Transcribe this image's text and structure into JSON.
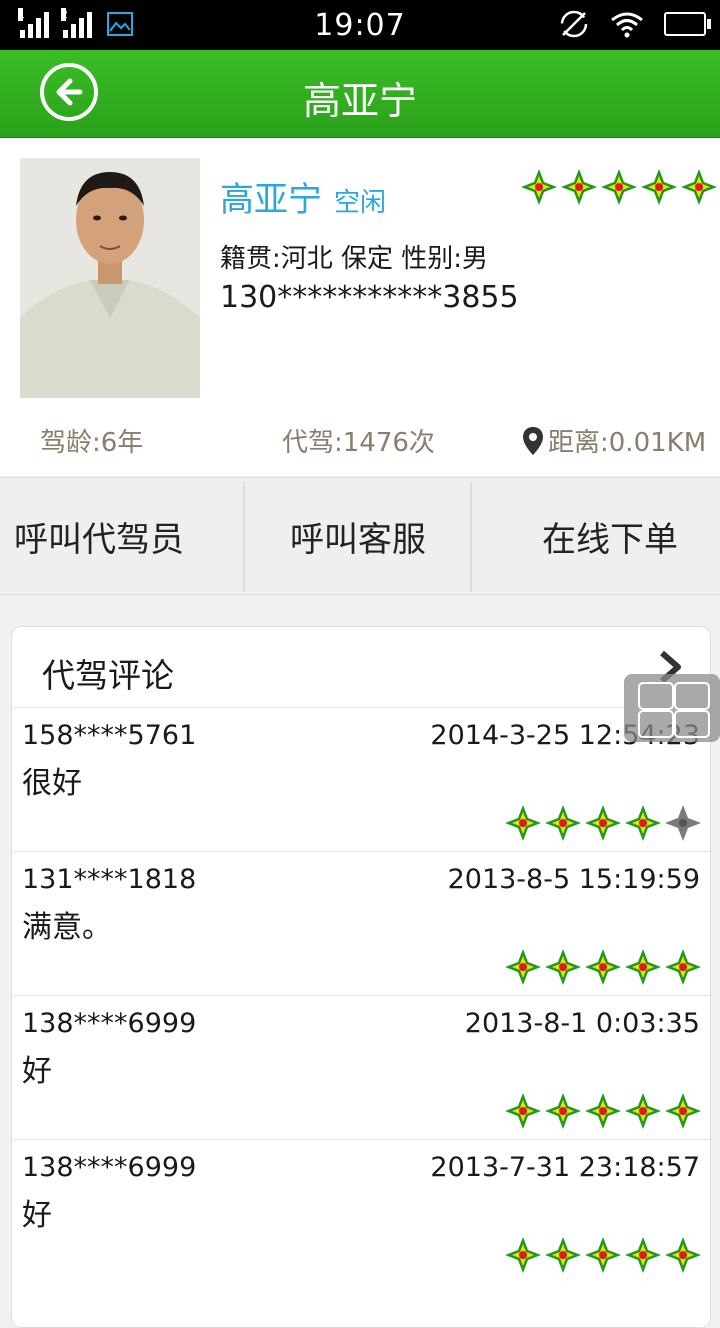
{
  "status_bar": {
    "time": "19:07",
    "sim1": "1",
    "sim2": "2",
    "icons": [
      "signal-icon",
      "image-icon",
      "rotation-icon",
      "wifi-icon",
      "battery-icon"
    ]
  },
  "header": {
    "title": "高亚宁",
    "back_icon": "back-arrow-icon"
  },
  "driver": {
    "name": "高亚宁",
    "status": "空闲",
    "rating": 5,
    "origin_gender": "籍贯:河北 保定   性别:男",
    "phone": "130***********3855",
    "driving_age": "驾龄:6年",
    "drive_count": "代驾:1476次",
    "distance": "距离:0.01KM"
  },
  "actions": {
    "call_driver": "呼叫代驾员",
    "call_service": "呼叫客服",
    "order_online": "在线下单"
  },
  "reviews": {
    "title": "代驾评论",
    "items": [
      {
        "user": "158****5761",
        "date": "2014-3-25 12:54:23",
        "text": "很好",
        "rating": 4
      },
      {
        "user": "131****1818",
        "date": "2013-8-5 15:19:59",
        "text": "满意。",
        "rating": 5
      },
      {
        "user": "138****6999",
        "date": "2013-8-1 0:03:35",
        "text": "好",
        "rating": 5
      },
      {
        "user": "138****6999",
        "date": "2013-7-31 23:18:57",
        "text": "好",
        "rating": 5
      }
    ]
  },
  "colors": {
    "header_green": "#2fae1f",
    "name_blue": "#29a7e1",
    "stat_brown": "#8b7d6b",
    "star_green": "#1f9a20",
    "star_yellow": "#f5e100",
    "star_red": "#e01b1b",
    "star_off": "#7a7a7a"
  }
}
